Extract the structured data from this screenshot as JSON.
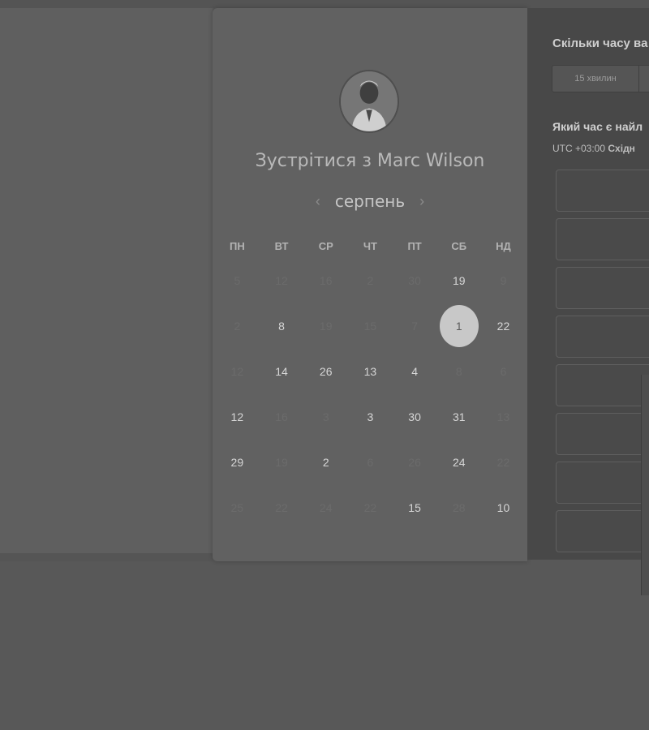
{
  "host": {
    "title": "Зустрітися з Marc Wilson",
    "avatar_icon": "person-photo"
  },
  "calendar": {
    "month": "серпень",
    "prev_icon": "‹",
    "next_icon": "›",
    "weekdays": [
      "ПН",
      "ВТ",
      "СР",
      "ЧТ",
      "ПТ",
      "СБ",
      "НД"
    ],
    "rows": [
      [
        {
          "d": "5",
          "a": false
        },
        {
          "d": "12",
          "a": false
        },
        {
          "d": "16",
          "a": false
        },
        {
          "d": "2",
          "a": false
        },
        {
          "d": "30",
          "a": false
        },
        {
          "d": "19",
          "a": true
        },
        {
          "d": "9",
          "a": false
        }
      ],
      [
        {
          "d": "2",
          "a": false
        },
        {
          "d": "8",
          "a": true
        },
        {
          "d": "19",
          "a": false
        },
        {
          "d": "15",
          "a": false
        },
        {
          "d": "7",
          "a": false
        },
        {
          "d": "1",
          "a": true,
          "selected": true
        },
        {
          "d": "22",
          "a": true
        }
      ],
      [
        {
          "d": "12",
          "a": false
        },
        {
          "d": "14",
          "a": true
        },
        {
          "d": "26",
          "a": true
        },
        {
          "d": "13",
          "a": true
        },
        {
          "d": "4",
          "a": true
        },
        {
          "d": "8",
          "a": false
        },
        {
          "d": "6",
          "a": false
        }
      ],
      [
        {
          "d": "12",
          "a": true
        },
        {
          "d": "16",
          "a": false
        },
        {
          "d": "3",
          "a": false
        },
        {
          "d": "3",
          "a": true
        },
        {
          "d": "30",
          "a": true
        },
        {
          "d": "31",
          "a": true
        },
        {
          "d": "13",
          "a": false
        }
      ],
      [
        {
          "d": "29",
          "a": true
        },
        {
          "d": "19",
          "a": false
        },
        {
          "d": "2",
          "a": true
        },
        {
          "d": "6",
          "a": false
        },
        {
          "d": "26",
          "a": false
        },
        {
          "d": "24",
          "a": true
        },
        {
          "d": "22",
          "a": false
        }
      ],
      [
        {
          "d": "25",
          "a": false
        },
        {
          "d": "22",
          "a": false
        },
        {
          "d": "24",
          "a": false
        },
        {
          "d": "22",
          "a": false
        },
        {
          "d": "15",
          "a": true
        },
        {
          "d": "28",
          "a": false
        },
        {
          "d": "10",
          "a": true
        }
      ]
    ]
  },
  "scheduler": {
    "duration_question": "Скільки часу ва",
    "duration_tabs": [
      "15 хвилин",
      ""
    ],
    "time_question": "Який час є найл",
    "timezone_prefix": "UTC +03:00",
    "timezone_name": "Східн",
    "slots": [
      "",
      "",
      "",
      "",
      "",
      "",
      "",
      ""
    ]
  }
}
